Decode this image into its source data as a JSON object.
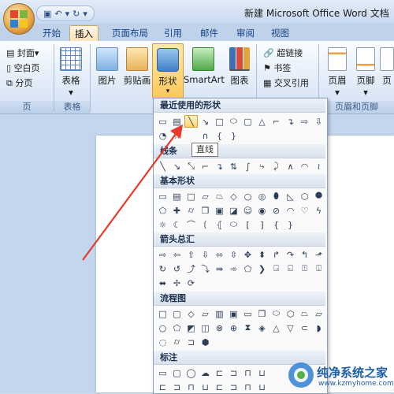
{
  "window": {
    "title": "新建 Microsoft Office Word 文档"
  },
  "tabs": [
    "开始",
    "插入",
    "页面布局",
    "引用",
    "邮件",
    "审阅",
    "视图"
  ],
  "active_tab": "插入",
  "ribbon": {
    "pages_group": {
      "label": "页",
      "items": [
        "封面",
        "空白页",
        "分页"
      ]
    },
    "table_group": {
      "label": "表格",
      "button": "表格"
    },
    "illustrations": {
      "picture": "图片",
      "clipart": "剪贴画",
      "shapes": "形状",
      "smartart": "SmartArt",
      "chart": "图表"
    },
    "links": {
      "hyperlink": "超链接",
      "bookmark": "书签",
      "crossref": "交叉引用"
    },
    "header_footer_group": {
      "label": "页眉和页脚",
      "header": "页眉",
      "footer": "页脚",
      "more": "页"
    }
  },
  "shapes_menu": {
    "sections": [
      "最近使用的形状",
      "线条",
      "基本形状",
      "箭头总汇",
      "流程图",
      "标注"
    ],
    "tooltip": "直线"
  },
  "colors": {
    "accent": "#fcc85b",
    "arrow": "#e8372c"
  },
  "watermark": {
    "name": "纯净系统之家",
    "url": "www.kzmyhome.com"
  }
}
